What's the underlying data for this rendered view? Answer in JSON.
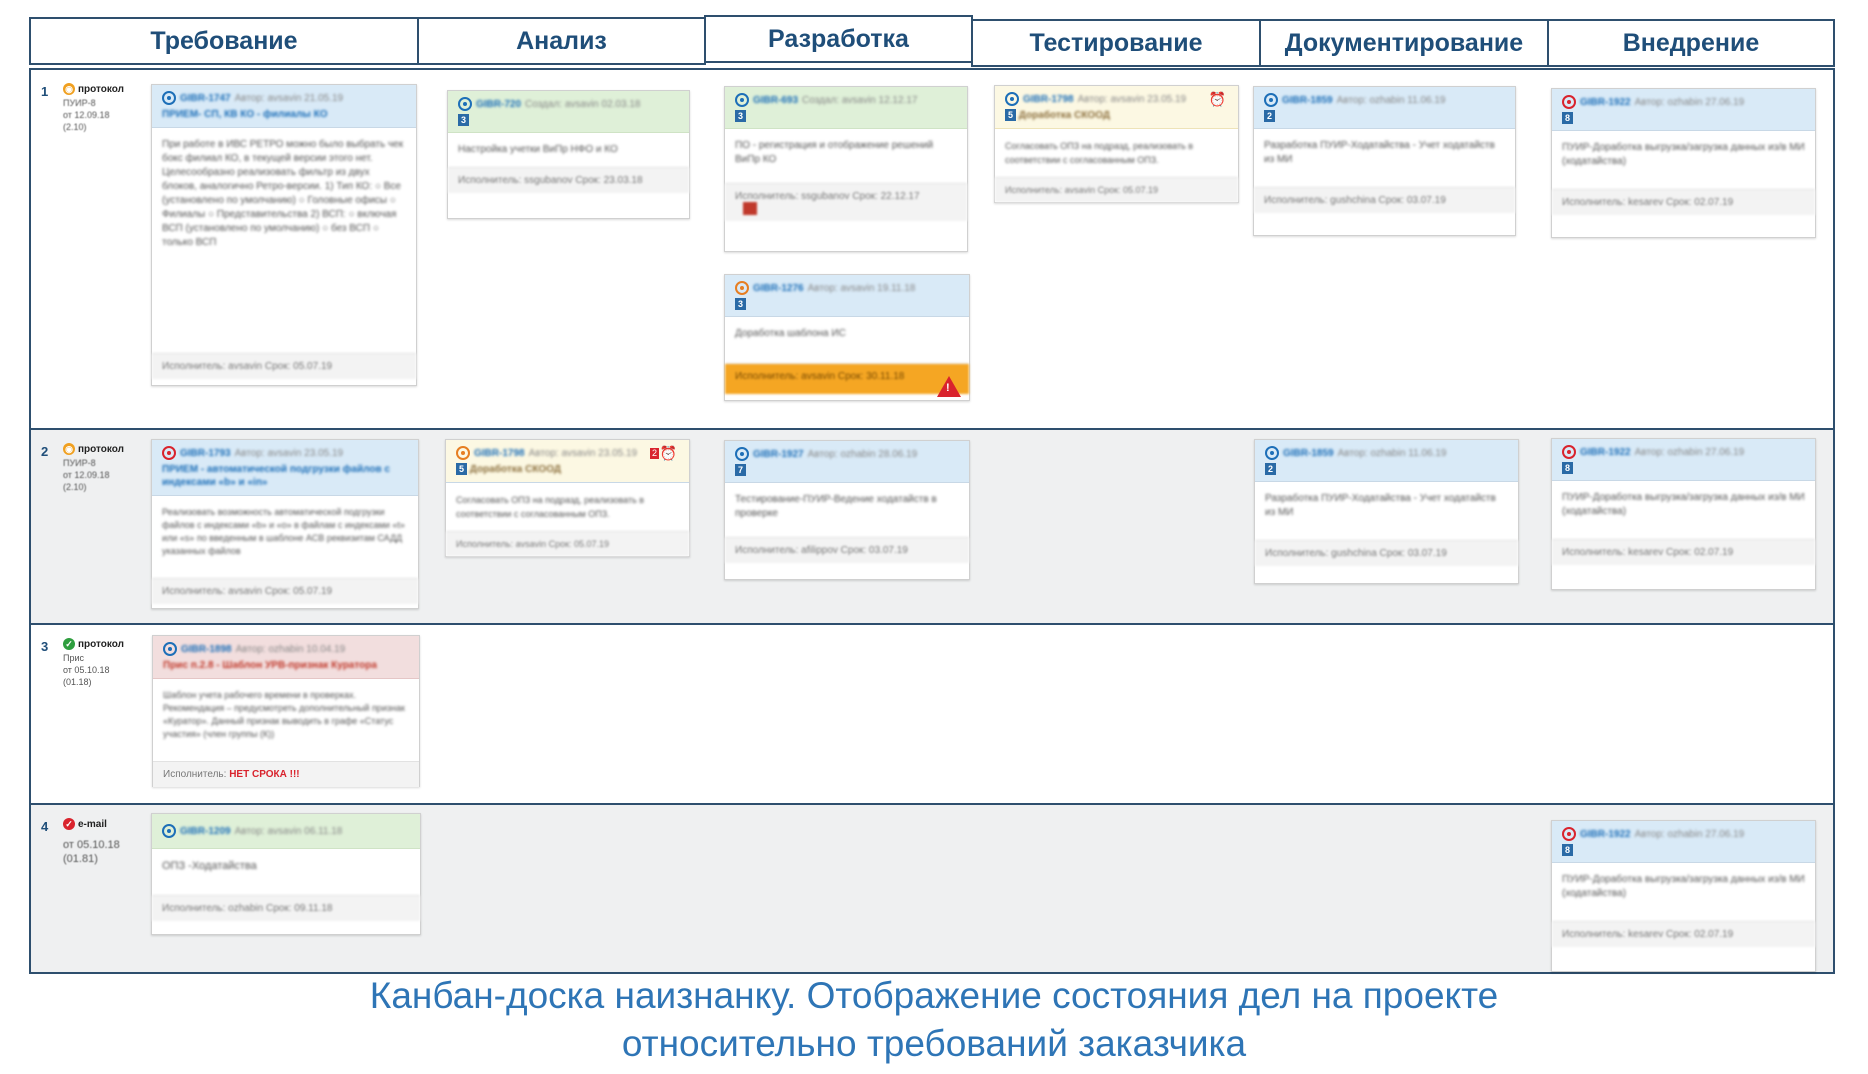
{
  "columns": [
    "Требование",
    "Анализ",
    "Разработка",
    "Тестирование",
    "Документирование",
    "Внедрение"
  ],
  "rows": [
    {
      "num": "1",
      "source": {
        "label": "протокол",
        "meta": [
          "ПУИР-8",
          "от 12.09.18",
          "(2.10)"
        ],
        "color": "#f0a020"
      }
    },
    {
      "num": "2",
      "source": {
        "label": "протокол",
        "meta": [
          "ПУИР-8",
          "от 12.09.18",
          "(2.10)"
        ],
        "color": "#f0a020"
      }
    },
    {
      "num": "3",
      "source": {
        "label": "протокол",
        "meta": [
          "Прис",
          "от 05.10.18",
          "(01.18)"
        ],
        "color": "#2e9e3e"
      }
    },
    {
      "num": "4",
      "source": {
        "label": "e-mail",
        "meta": [
          "от 05.10.18",
          "(01.81)"
        ],
        "color": "#d9232d"
      }
    }
  ],
  "cards": {
    "r1_req": {
      "id": "GIBR-1747",
      "author": "Автор: avsavin 21.05.19",
      "title": "ПРИЕМ- СП, КВ КО - филиалы КО",
      "body": "При работе в ИВС РЕТРО можно было выбрать чек бокс филиал КО, в текущей версии этого нет. Целесообразно реализовать фильтр из двух блоков, аналогично Ретро-версии. 1) Тип КО: ○ Все (установлено по умолчанию) ○ Головные офисы ○ Филиалы ○ Представительства 2) ВСП: ○ включая ВСП (установлено по умолчанию) ○ без ВСП ○ только ВСП",
      "footer": "Исполнитель: avsavin Срок: 05.07.19"
    },
    "r1_an": {
      "id": "GIBR-720",
      "author": "Создал: avsavin 02.03.18",
      "num": "3",
      "body": "Настройка учетки ВиПр НФО и КО",
      "footer": "Исполнитель: ssgubanov Срок: 23.03.18"
    },
    "r1_dev1": {
      "id": "GIBR-693",
      "author": "Создал: avsavin 12.12.17",
      "num": "3",
      "body": "ПО - регистрация и отображение решений ВиПр КО",
      "footer": "Исполнитель: ssgubanov Срок: 22.12.17"
    },
    "r1_dev2": {
      "id": "GIBR-1276",
      "author": "Автор: avsavin 19.11.18",
      "num": "3",
      "body": "Доработка шаблона ИС",
      "footer": "Исполнитель: avsavin Срок: 30.11.18"
    },
    "r1_test": {
      "id": "GIBR-1798",
      "author": "Автор: avsavin 23.05.19",
      "num": "5",
      "title": "Доработка СКООД",
      "body": "Согласовать ОПЗ на подразд, реализовать в соответствии с согласованным ОПЗ.",
      "footer": "Исполнитель: avsavin Срок: 05.07.19"
    },
    "r1_doc": {
      "id": "GIBR-1859",
      "author": "Автор: ozhabin 11.06.19",
      "num": "2",
      "body": "Разработка ПУИР-Ходатайства - Учет ходатайств из МИ",
      "footer": "Исполнитель: gushchina Срок: 03.07.19"
    },
    "r1_impl": {
      "id": "GIBR-1922",
      "author": "Автор: ozhabin 27.06.19",
      "num": "8",
      "body": "ПУИР-Доработка выгрузка/загрузка данных из/в МИ (ходатайства)",
      "footer": "Исполнитель: kesarev Срок: 02.07.19"
    },
    "r2_req": {
      "id": "GIBR-1793",
      "author": "Автор: avsavin 23.05.19",
      "title": "ПРИЕМ - автоматической подгрузки файлов с индексами «b» и «in»",
      "body": "Реализовать возможность автоматической подгрузки файлов с индексами «b» и «o» в файлам с индексами «t» или «s» по введенным в шаблоне АСВ реквизитам САДД указанных файлов",
      "footer": "Исполнитель: avsavin Срок: 05.07.19"
    },
    "r2_an": {
      "id": "GIBR-1798",
      "author": "Автор: avsavin 23.05.19",
      "num": "5",
      "title": "Доработка СКООД",
      "flag": "2",
      "body": "Согласовать ОПЗ на подразд, реализовать в соответствии с согласованным ОПЗ.",
      "footer": "Исполнитель: avsavin Срок: 05.07.19"
    },
    "r2_dev": {
      "id": "GIBR-1927",
      "author": "Автор: ozhabin 28.06.19",
      "num": "7",
      "body": "Тестирование-ПУИР-Ведение ходатайств в проверке",
      "footer": "Исполнитель: afilippov Срок: 03.07.19"
    },
    "r2_doc": {
      "id": "GIBR-1859",
      "author": "Автор: ozhabin 11.06.19",
      "num": "2",
      "body": "Разработка ПУИР-Ходатайства - Учет ходатайств из МИ",
      "footer": "Исполнитель: gushchina Срок: 03.07.19"
    },
    "r2_impl": {
      "id": "GIBR-1922",
      "author": "Автор: ozhabin 27.06.19",
      "num": "8",
      "body": "ПУИР-Доработка выгрузка/загрузка данных из/в МИ (ходатайства)",
      "footer": "Исполнитель: kesarev Срок: 02.07.19"
    },
    "r3_req": {
      "id": "GIBR-1898",
      "author": "Автор: ozhabin 10.04.19",
      "title": "Прис п.2.8 - Шаблон УРВ-признак Куратора",
      "body": "Шаблон учета рабочего времени в проверках. Рекомендация – предусмотреть дополнительный признак «Куратор». Данный признак выводить в графе «Статус участия» (член группы (К))",
      "footer_label": "Исполнитель:",
      "footer_value": "НЕТ СРОКА !!!"
    },
    "r4_req": {
      "id": "GIBR-1209",
      "author": "Автор: avsavin 06.11.18",
      "body": "ОПЗ -Ходатайства",
      "footer": "Исполнитель: ozhabin Срок: 09.11.18"
    },
    "r4_impl": {
      "id": "GIBR-1922",
      "author": "Автор: ozhabin 27.06.19",
      "num": "8",
      "body": "ПУИР-Доработка выгрузка/загрузка данных из/в МИ (ходатайства)",
      "footer": "Исполнитель: kesarev Срок: 02.07.19"
    }
  },
  "caption": [
    "Канбан-доска наизнанку. Отображение состояния дел на проекте",
    "относительно требований заказчика"
  ]
}
